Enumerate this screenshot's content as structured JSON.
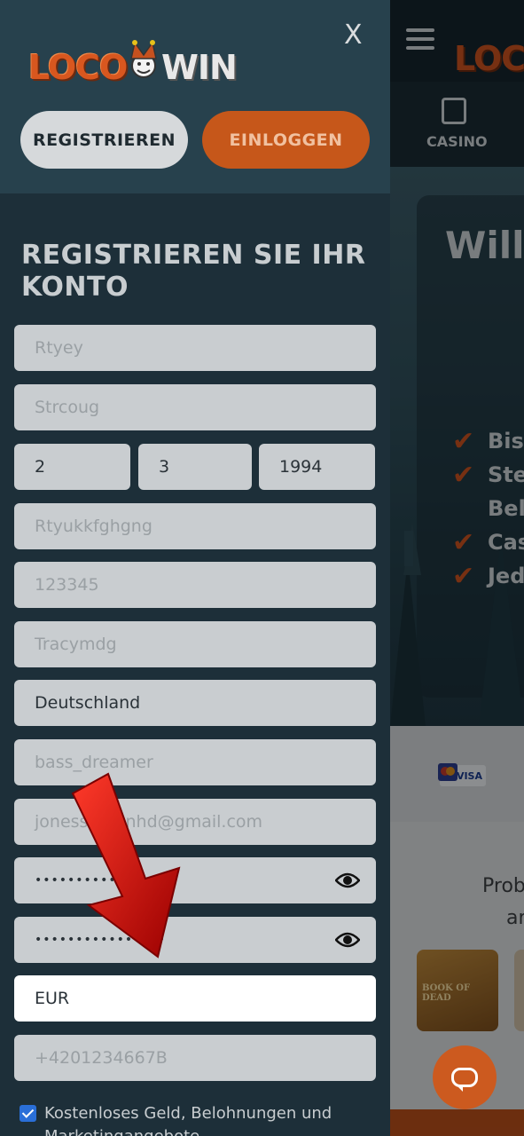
{
  "panel": {
    "logo_left": "LOCO",
    "logo_right": "WIN",
    "close_label": "X",
    "register_button": "REGISTRIEREN",
    "login_button": "EINLOGGEN",
    "form_title": "REGISTRIEREN SIE IHR KONTO"
  },
  "form": {
    "first_name": "Rtyey",
    "last_name": "Strcoug",
    "birth_day": "2",
    "birth_month": "3",
    "birth_year": "1994",
    "street": "Rtyukkfghgng",
    "postal_code": "123345",
    "city": "Tracymdg",
    "country": "Deutschland",
    "username": "bass_dreamer",
    "email": "jonesstevenhd@gmail.com",
    "password": "••••••••••••",
    "password_confirm": "••••••••••••••••",
    "currency": "EUR",
    "phone": "+4201234667B",
    "marketing_consent_label": "Kostenloses Geld, Belohnungen und Marketingangebote"
  },
  "site": {
    "logo_fragment": "LOC",
    "nav_casino": "CASINO",
    "hero_title": "Will",
    "bullets": [
      "Bis",
      "Ste",
      "Bel",
      "Cas",
      "Jed"
    ],
    "payment_visa": "VISA",
    "promo_line1": "Prob",
    "promo_line2": "an",
    "game_title": "BOOK OF DEAD"
  },
  "colors": {
    "accent": "#c6571a",
    "panel_bg": "#1d2f39",
    "header_bg": "#27414d",
    "input_bg": "#c9cdd0",
    "active_input_bg": "#ffffff",
    "arrow": "#d10000"
  }
}
